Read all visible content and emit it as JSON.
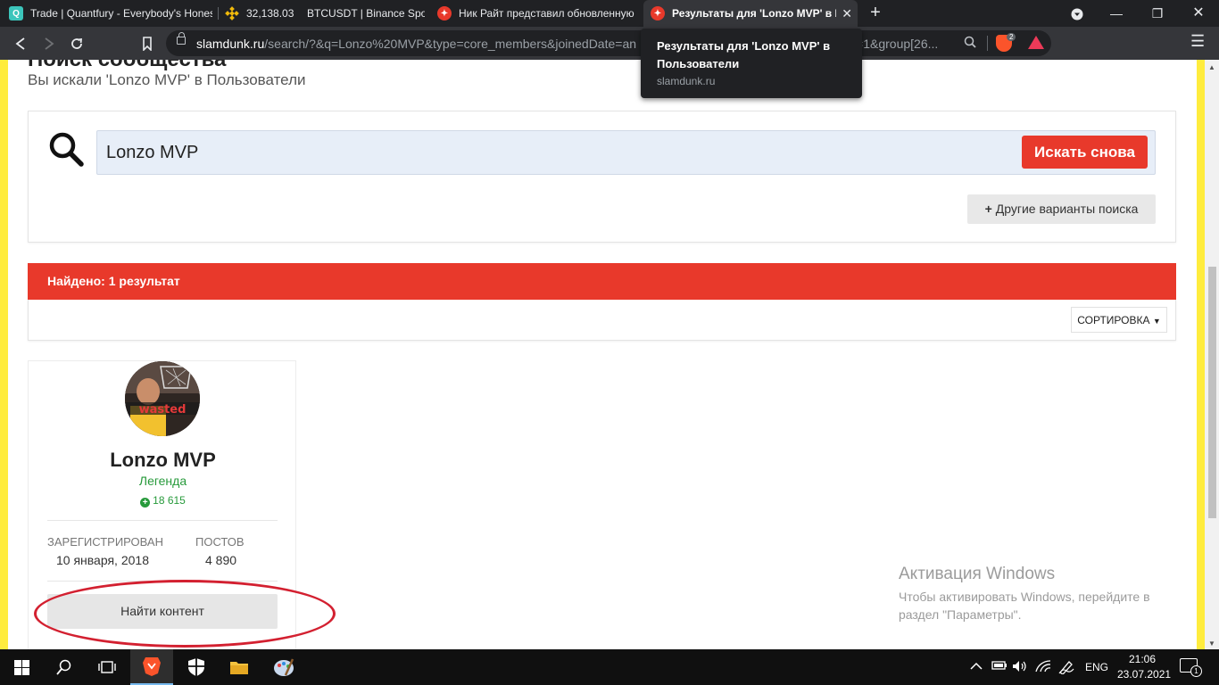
{
  "browser": {
    "tabs": [
      {
        "title": "Trade | Quantfury - Everybody's Hones",
        "favicon": "quantfury-icon",
        "favicon_color": "#3cc5bb"
      },
      {
        "title": "32,138.03",
        "favicon": "binance-icon",
        "favicon_color": "#f0b90b"
      },
      {
        "title": "BTCUSDT | Binance Spot",
        "favicon": "none"
      },
      {
        "title": "Ник Райт представил обновленную",
        "favicon": "slamdunk-icon",
        "favicon_color": "#e8392b"
      },
      {
        "title": "Результаты для 'Lonzo MVP' в По",
        "favicon": "slamdunk-icon",
        "favicon_color": "#e8392b",
        "active": true
      }
    ],
    "url_host": "slamdunk.ru",
    "url_path": "/search/?&q=Lonzo%20MVP&type=core_members&joinedDate=an",
    "url_tail": "=1&group[26...",
    "brave_badge": "2",
    "tooltip": {
      "title": "Результаты для 'Lonzo MVP' в Пользователи",
      "host": "slamdunk.ru"
    }
  },
  "page": {
    "title": "Поиск сообщества",
    "subtitle": "Вы искали 'Lonzo MVP' в Пользователи",
    "search": {
      "value": "Lonzo MVP",
      "search_again": "Искать снова",
      "more_options": "Другие варианты поиска"
    },
    "results": {
      "count_label": "Найдено: 1 результат",
      "sort_label": "СОРТИРОВКА"
    },
    "member": {
      "name": "Lonzo MVP",
      "group": "Легенда",
      "reputation": "18 615",
      "avatar_caption": "wasted",
      "joined_label": "ЗАРЕГИСТРИРОВАН",
      "joined_value": "10 января, 2018",
      "posts_label": "ПОСТОВ",
      "posts_value": "4 890",
      "find_content": "Найти контент"
    },
    "colors": {
      "accent": "#e8392b",
      "side_stripe": "#ffec3d",
      "group_color": "#279a3b"
    }
  },
  "windows_watermark": {
    "title": "Активация Windows",
    "text": "Чтобы активировать Windows, перейдите в раздел \"Параметры\"."
  },
  "taskbar": {
    "lang": "ENG",
    "time": "21:06",
    "date": "23.07.2021",
    "notifications": "1"
  }
}
